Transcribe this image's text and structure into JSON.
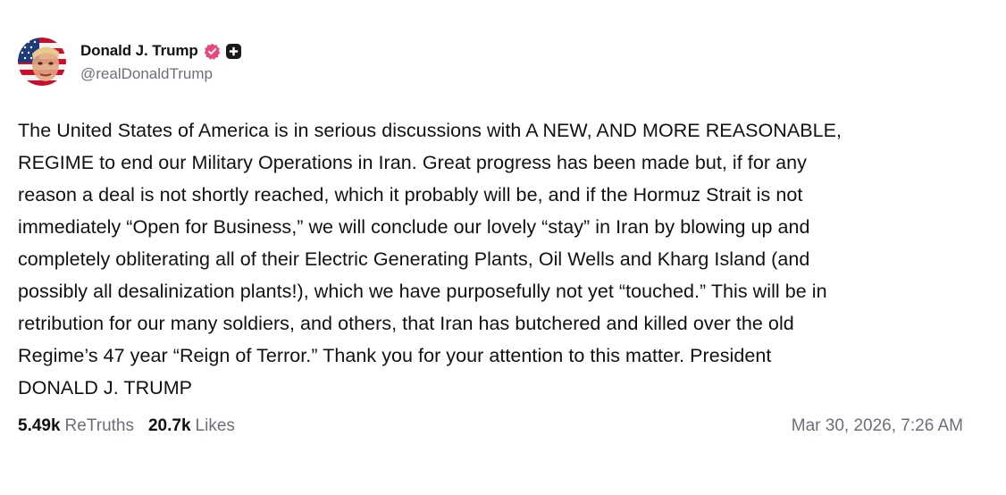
{
  "author": {
    "display_name": "Donald J. Trump",
    "handle": "@realDonaldTrump",
    "verified": true,
    "verified_color": "#e8467c",
    "plus_badge": true
  },
  "post": {
    "text": "The United States of America is in serious discussions with A NEW, AND MORE REASONABLE,\nREGIME to end our Military Operations in Iran. Great progress has been made but, if for any\nreason a deal is not shortly reached, which it probably will be, and if the Hormuz Strait is not\nimmediately “Open for Business,” we will conclude our lovely “stay” in Iran by blowing up and\ncompletely obliterating all of their Electric Generating Plants, Oil Wells and Kharg Island (and\npossibly all desalinization plants!), which we have purposefully not yet “touched.” This will be in\nretribution for our many soldiers, and others, that Iran has butchered and killed over the old\nRegime’s 47 year “Reign of Terror.” Thank you for your attention to this matter. President\nDONALD J. TRUMP"
  },
  "stats": {
    "retruths_count": "5.49k",
    "retruths_label": "ReTruths",
    "likes_count": "20.7k",
    "likes_label": "Likes"
  },
  "timestamp": "Mar 30, 2026, 7:26 AM"
}
